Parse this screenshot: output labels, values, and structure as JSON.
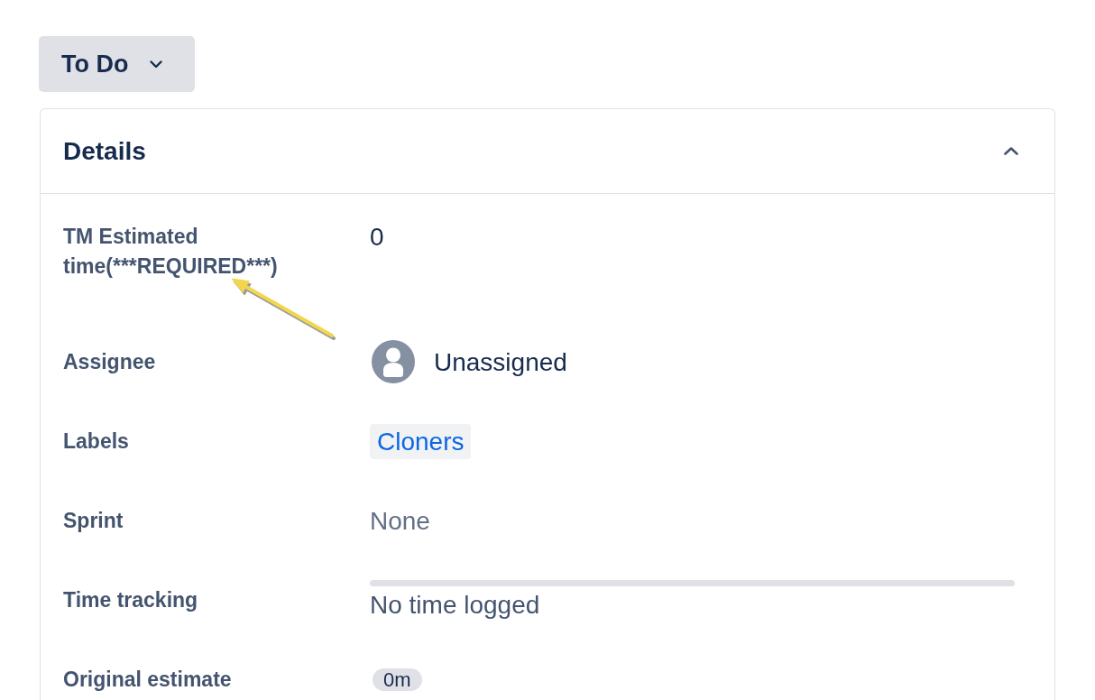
{
  "status_button": {
    "label": "To Do"
  },
  "details": {
    "title": "Details",
    "expanded": true,
    "fields": [
      {
        "label": "TM Estimated time(***REQUIRED***)",
        "kind": "text",
        "value": "0"
      },
      {
        "label": "Assignee",
        "kind": "user",
        "value": "Unassigned"
      },
      {
        "label": "Labels",
        "kind": "tags",
        "tags": [
          "Cloners"
        ]
      },
      {
        "label": "Sprint",
        "kind": "empty",
        "value": "None"
      },
      {
        "label": "Time tracking",
        "kind": "progress",
        "level": 0,
        "value": "No time logged"
      },
      {
        "label": "Original estimate",
        "kind": "lozenge",
        "value": "0m"
      }
    ]
  }
}
